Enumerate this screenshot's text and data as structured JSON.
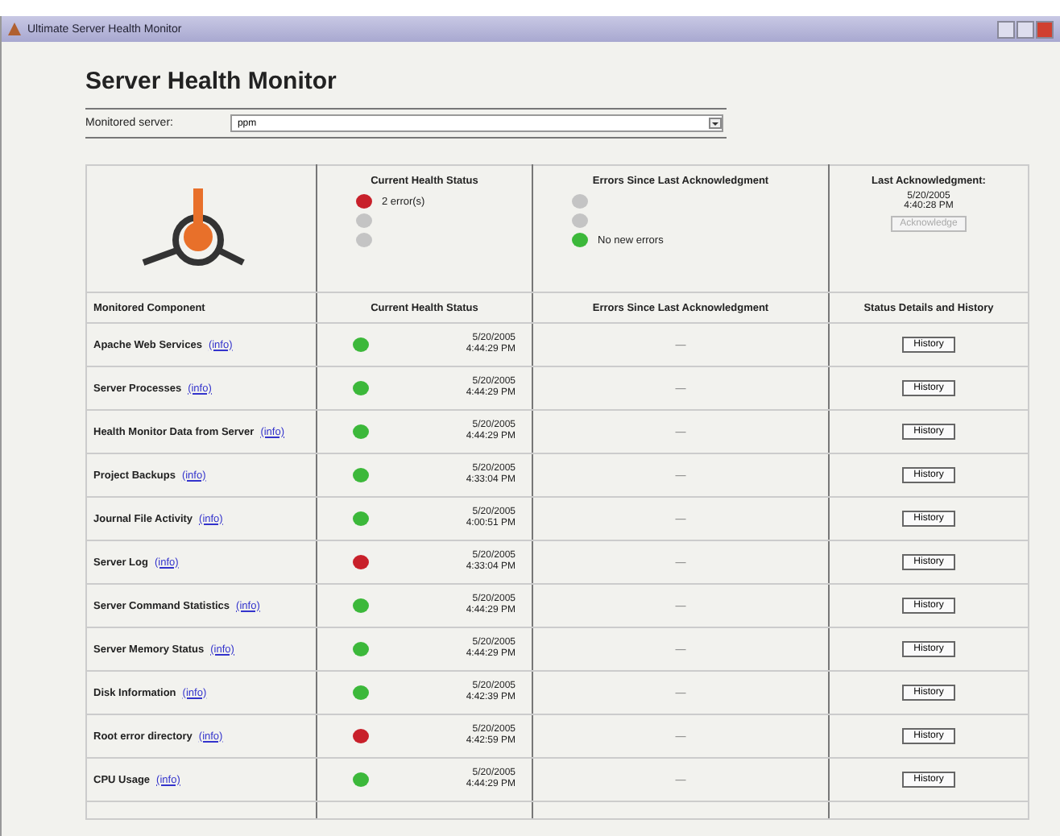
{
  "window": {
    "title": "Ultimate Server Health Monitor"
  },
  "heading": "Server Health Monitor",
  "server": {
    "label": "Monitored server:",
    "value": "ppm"
  },
  "summary": {
    "health_title": "Current Health Status",
    "health_legend": [
      {
        "color": "#c8202a",
        "text": "2 error(s)"
      },
      {
        "color": "#c4c4c4"
      },
      {
        "color": "#c4c4c4"
      }
    ],
    "errors_title": "Errors Since Last Acknowledgment",
    "errors_legend": [
      {
        "color": "#c4c4c4"
      },
      {
        "color": "#c4c4c4"
      },
      {
        "color": "#3cb83a",
        "text": "No new errors"
      }
    ],
    "ack_title": "Last Acknowledgment:",
    "ack_date": "5/20/2005",
    "ack_time": "4:40:28 PM",
    "ack_button": {
      "label": "Acknowledge",
      "disabled": true
    }
  },
  "table": {
    "columns": [
      "Monitored Component",
      "Current Health Status",
      "Errors Since Last Acknowledgment",
      "Status Details and History"
    ],
    "rows": [
      {
        "component": "Apache Web Services",
        "link": "(info)",
        "color": "#3cb83a",
        "date": "5/20/2005",
        "time": "4:44:29 PM",
        "errors": "—",
        "button": "History"
      },
      {
        "component": "Server Processes",
        "link": "(info)",
        "color": "#3cb83a",
        "date": "5/20/2005",
        "time": "4:44:29 PM",
        "errors": "—",
        "button": "History"
      },
      {
        "component": "Health Monitor Data from Server",
        "link": "(info)",
        "color": "#3cb83a",
        "date": "5/20/2005",
        "time": "4:44:29 PM",
        "errors": "—",
        "button": "History"
      },
      {
        "component": "Project Backups",
        "link": "(info)",
        "color": "#3cb83a",
        "date": "5/20/2005",
        "time": "4:33:04 PM",
        "errors": "—",
        "button": "History"
      },
      {
        "component": "Journal File Activity",
        "link": "(info)",
        "color": "#3cb83a",
        "date": "5/20/2005",
        "time": "4:00:51 PM",
        "errors": "—",
        "button": "History"
      },
      {
        "component": "Server Log",
        "link": "(info)",
        "color": "#c8202a",
        "date": "5/20/2005",
        "time": "4:33:04 PM",
        "errors": "—",
        "button": "History"
      },
      {
        "component": "Server Command Statistics",
        "link": "(info)",
        "color": "#3cb83a",
        "date": "5/20/2005",
        "time": "4:44:29 PM",
        "errors": "—",
        "button": "History"
      },
      {
        "component": "Server Memory Status",
        "link": "(info)",
        "color": "#3cb83a",
        "date": "5/20/2005",
        "time": "4:44:29 PM",
        "errors": "—",
        "button": "History"
      },
      {
        "component": "Disk Information",
        "link": "(info)",
        "color": "#3cb83a",
        "date": "5/20/2005",
        "time": "4:42:39 PM",
        "errors": "—",
        "button": "History"
      },
      {
        "component": "Root error directory",
        "link": "(info)",
        "color": "#c8202a",
        "date": "5/20/2005",
        "time": "4:42:59 PM",
        "errors": "—",
        "button": "History"
      },
      {
        "component": "CPU Usage",
        "link": "(info)",
        "color": "#3cb83a",
        "date": "5/20/2005",
        "time": "4:44:29 PM",
        "errors": "—",
        "button": "History"
      }
    ]
  }
}
